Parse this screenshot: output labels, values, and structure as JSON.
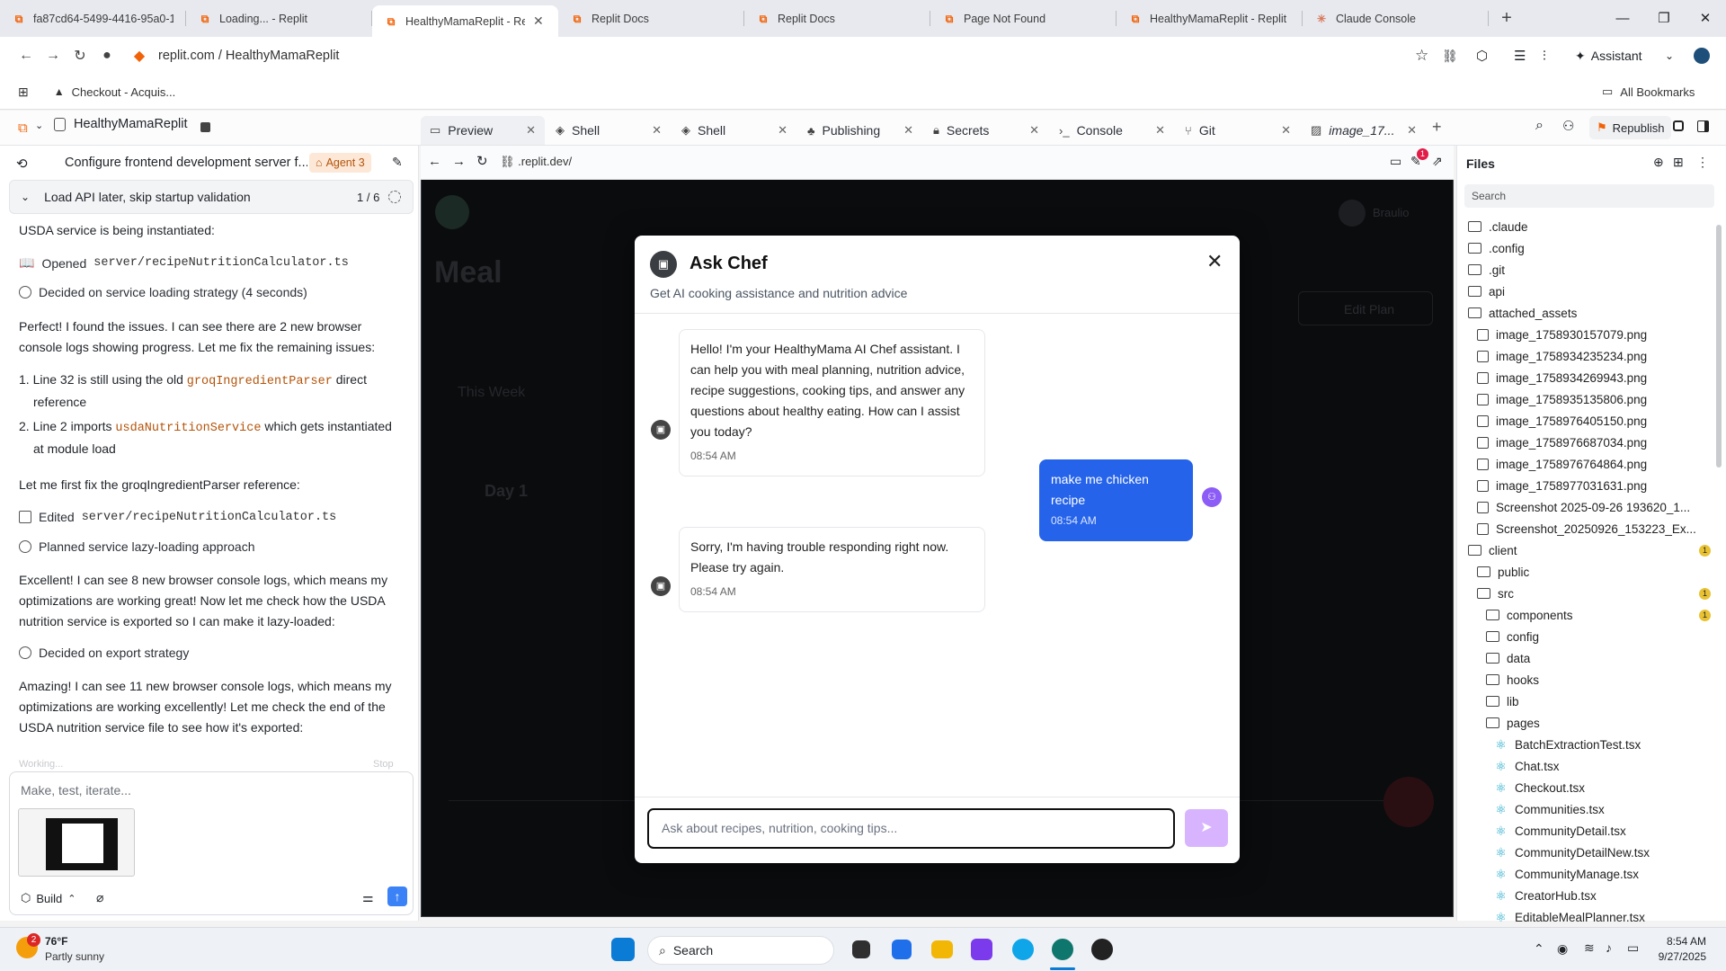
{
  "browser": {
    "tabs": [
      {
        "label": "fa87cd64-5499-4416-95a0-1b",
        "active": false,
        "icon": "replit"
      },
      {
        "label": "Loading... - Replit",
        "active": false,
        "icon": "replit"
      },
      {
        "label": "HealthyMamaReplit - Replit",
        "active": true,
        "icon": "replit"
      },
      {
        "label": "Replit Docs",
        "active": false,
        "icon": "replit"
      },
      {
        "label": "Replit Docs",
        "active": false,
        "icon": "replit"
      },
      {
        "label": "Page Not Found",
        "active": false,
        "icon": "replit"
      },
      {
        "label": "HealthyMamaReplit - Replit",
        "active": false,
        "icon": "replit"
      },
      {
        "label": "Claude Console",
        "active": false,
        "icon": "claude"
      }
    ],
    "url": "replit.com / HealthyMamaReplit",
    "assistant_label": "Assistant",
    "bookmark": "Checkout - Acquis...",
    "all_bookmarks": "All Bookmarks"
  },
  "replit": {
    "project_name": "HealthyMamaReplit",
    "workspace_tabs": [
      {
        "label": "Preview",
        "icon": "monitor-icon",
        "active": true
      },
      {
        "label": "Shell",
        "icon": "shell-icon"
      },
      {
        "label": "Shell",
        "icon": "shell-icon"
      },
      {
        "label": "Publishing",
        "icon": "publish-icon"
      },
      {
        "label": "Secrets",
        "icon": "lock-icon"
      },
      {
        "label": "Console",
        "icon": "terminal-icon"
      },
      {
        "label": "Git",
        "icon": "git-icon"
      },
      {
        "label": "image_17...",
        "icon": "image-icon"
      }
    ],
    "republish_label": "Republish"
  },
  "agent": {
    "task_title": "Configure frontend development server f...",
    "agent_badge": "Agent 3",
    "step_title": "Load API later, skip startup validation",
    "step_counter": "1 / 6",
    "line0": "USDA service is being instantiated:",
    "opened_label": "Opened",
    "opened_file": "server/recipeNutritionCalculator.ts",
    "decided1": "Decided on service loading strategy (4 seconds)",
    "p1": "Perfect! I found the issues. I can see there are 2 new browser console logs showing progress. Let me fix the remaining issues:",
    "li1_pre": "Line 32 is still using the old",
    "li1_code": "groqIngredientParser",
    "li1_post": "direct",
    "li1_cont": "reference",
    "li2_pre": "Line 2 imports",
    "li2_code": "usdaNutritionService",
    "li2_post": "which gets instantiated",
    "li2_cont": "at module load",
    "p2": "Let me first fix the groqIngredientParser reference:",
    "edited_label": "Edited",
    "edited_file": "server/recipeNutritionCalculator.ts",
    "planned": "Planned service lazy-loading approach",
    "p3": "Excellent! I can see 8 new browser console logs, which means my optimizations are working great! Now let me check how the USDA nutrition service is exported so I can make it lazy-loaded:",
    "decided2": "Decided on export strategy",
    "p4": "Amazing! I can see 11 new browser console logs, which means my optimizations are working excellently! Let me check the end of the USDA nutrition service file to see how it's exported:",
    "working": "Working...",
    "stop": "Stop",
    "input_placeholder": "Make, test, iterate...",
    "build_label": "Build"
  },
  "preview": {
    "url": ".replit.dev/",
    "notif_count": "1",
    "bg": {
      "heading": "Meal",
      "week": "This Week",
      "day": "Day 1",
      "user": "Braulio",
      "edit": "Edit Plan"
    }
  },
  "chef": {
    "title": "Ask Chef",
    "subtitle": "Get AI cooking assistance and nutrition advice",
    "messages": [
      {
        "role": "bot",
        "text": "Hello! I'm your HealthyMama AI Chef assistant. I can help you with meal planning, nutrition advice, recipe suggestions, cooking tips, and answer any questions about healthy eating. How can I assist you today?",
        "time": "08:54 AM"
      },
      {
        "role": "user",
        "text": "make me chicken recipe",
        "time": "08:54 AM"
      },
      {
        "role": "bot",
        "text": "Sorry, I'm having trouble responding right now. Please try again.",
        "time": "08:54 AM"
      }
    ],
    "input_placeholder": "Ask about recipes, nutrition, cooking tips..."
  },
  "files": {
    "title": "Files",
    "search_placeholder": "Search",
    "items": [
      {
        "name": ".claude",
        "type": "folder",
        "depth": 0
      },
      {
        "name": ".config",
        "type": "folder",
        "depth": 0
      },
      {
        "name": ".git",
        "type": "folder",
        "depth": 0
      },
      {
        "name": "api",
        "type": "folder",
        "depth": 0
      },
      {
        "name": "attached_assets",
        "type": "folder",
        "depth": 0
      },
      {
        "name": "image_1758930157079.png",
        "type": "image",
        "depth": 1
      },
      {
        "name": "image_1758934235234.png",
        "type": "image",
        "depth": 1
      },
      {
        "name": "image_1758934269943.png",
        "type": "image",
        "depth": 1
      },
      {
        "name": "image_1758935135806.png",
        "type": "image",
        "depth": 1
      },
      {
        "name": "image_1758976405150.png",
        "type": "image",
        "depth": 1
      },
      {
        "name": "image_1758976687034.png",
        "type": "image",
        "depth": 1
      },
      {
        "name": "image_1758976764864.png",
        "type": "image",
        "depth": 1
      },
      {
        "name": "image_1758977031631.png",
        "type": "image",
        "depth": 1
      },
      {
        "name": "Screenshot 2025-09-26 193620_1...",
        "type": "image",
        "depth": 1
      },
      {
        "name": "Screenshot_20250926_153223_Ex...",
        "type": "image",
        "depth": 1
      },
      {
        "name": "client",
        "type": "folder",
        "depth": 0,
        "badge": "1"
      },
      {
        "name": "public",
        "type": "folder",
        "depth": 1
      },
      {
        "name": "src",
        "type": "folder",
        "depth": 1,
        "badge": "1"
      },
      {
        "name": "components",
        "type": "folder",
        "depth": 2,
        "badge": "1"
      },
      {
        "name": "config",
        "type": "folder",
        "depth": 2
      },
      {
        "name": "data",
        "type": "folder",
        "depth": 2
      },
      {
        "name": "hooks",
        "type": "folder",
        "depth": 2
      },
      {
        "name": "lib",
        "type": "folder",
        "depth": 2
      },
      {
        "name": "pages",
        "type": "folder",
        "depth": 2
      },
      {
        "name": "BatchExtractionTest.tsx",
        "type": "tsx",
        "depth": 3
      },
      {
        "name": "Chat.tsx",
        "type": "tsx",
        "depth": 3
      },
      {
        "name": "Checkout.tsx",
        "type": "tsx",
        "depth": 3
      },
      {
        "name": "Communities.tsx",
        "type": "tsx",
        "depth": 3
      },
      {
        "name": "CommunityDetail.tsx",
        "type": "tsx",
        "depth": 3
      },
      {
        "name": "CommunityDetailNew.tsx",
        "type": "tsx",
        "depth": 3
      },
      {
        "name": "CommunityManage.tsx",
        "type": "tsx",
        "depth": 3
      },
      {
        "name": "CreatorHub.tsx",
        "type": "tsx",
        "depth": 3
      },
      {
        "name": "EditableMealPlanner.tsx",
        "type": "tsx",
        "depth": 3
      }
    ]
  },
  "taskbar": {
    "temp": "76°F",
    "weather": "Partly sunny",
    "weather_badge": "2",
    "search": "Search",
    "time": "8:54 AM",
    "date": "9/27/2025"
  },
  "colors": {
    "accent": "#f26207",
    "user_bubble": "#2563eb",
    "send": "#d8b4fe"
  }
}
